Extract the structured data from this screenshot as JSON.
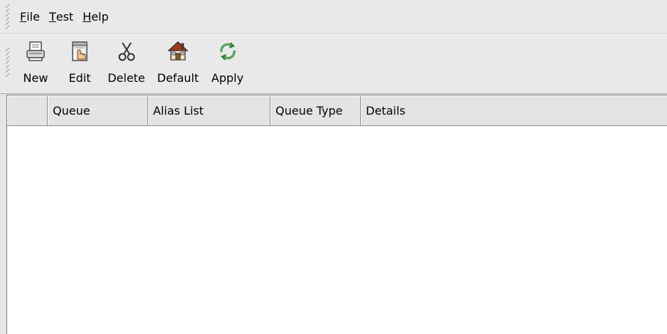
{
  "menubar": {
    "items": [
      {
        "mnemonic": "F",
        "rest": "ile"
      },
      {
        "mnemonic": "T",
        "rest": "est"
      },
      {
        "mnemonic": "H",
        "rest": "elp"
      }
    ]
  },
  "toolbar": {
    "buttons": [
      {
        "label": "New",
        "icon": "printer-new-icon"
      },
      {
        "label": "Edit",
        "icon": "edit-hand-icon"
      },
      {
        "label": "Delete",
        "icon": "scissors-icon"
      },
      {
        "label": "Default",
        "icon": "home-icon"
      },
      {
        "label": "Apply",
        "icon": "refresh-arrows-icon"
      }
    ]
  },
  "table": {
    "columns": [
      "",
      "Queue",
      "Alias List",
      "Queue Type",
      "Details"
    ],
    "rows": []
  }
}
